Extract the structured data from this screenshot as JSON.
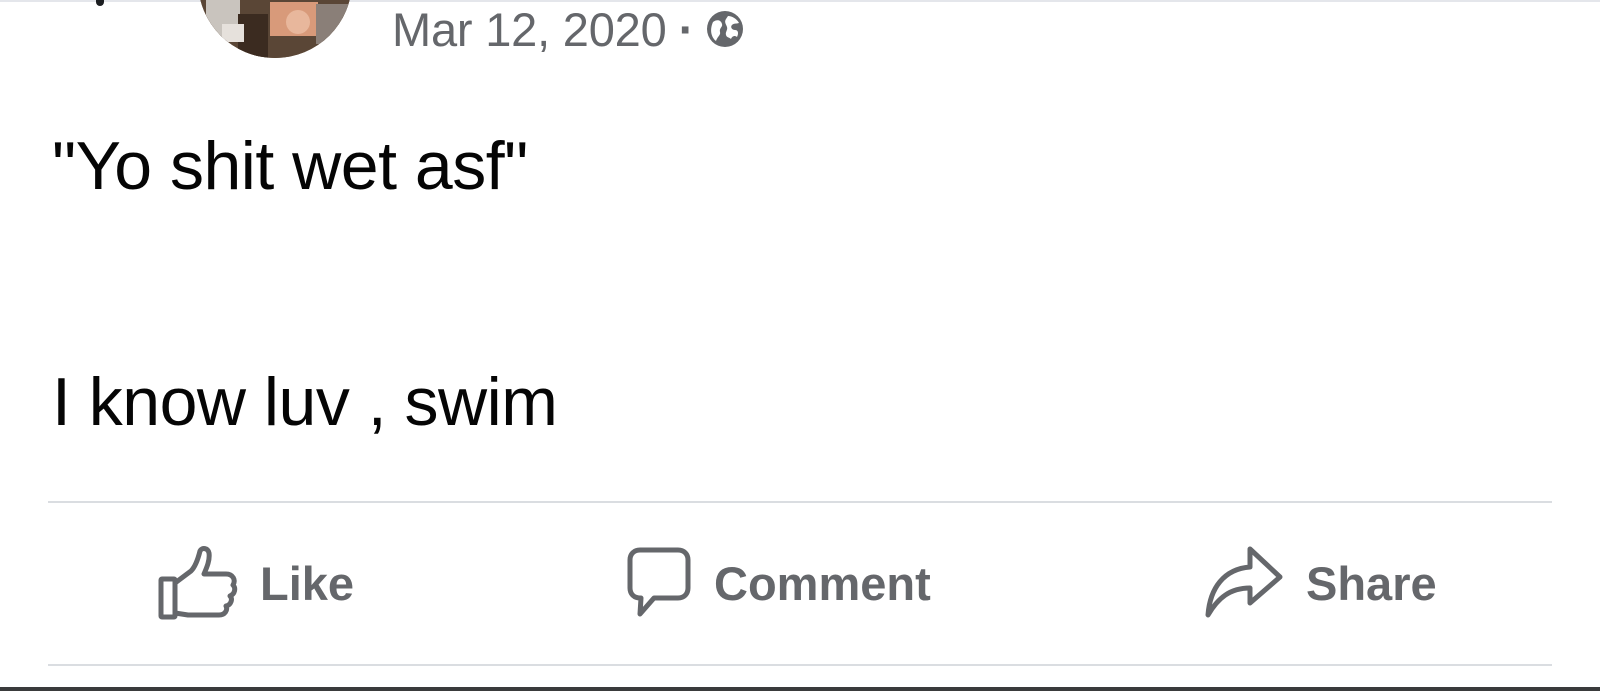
{
  "post": {
    "date": "Mar 12, 2020",
    "separator": "·",
    "privacy_icon": "globe-icon",
    "text_lines": [
      "\"Yo shit wet asf\"",
      "I know luv , swim"
    ]
  },
  "actions": {
    "like": {
      "label": "Like",
      "icon": "thumbs-up-icon"
    },
    "comment": {
      "label": "Comment",
      "icon": "comment-bubble-icon"
    },
    "share": {
      "label": "Share",
      "icon": "share-arrow-icon"
    }
  },
  "colors": {
    "meta_text": "#65676b",
    "body_text": "#050505",
    "divider": "#dadde1",
    "background": "#ffffff"
  }
}
